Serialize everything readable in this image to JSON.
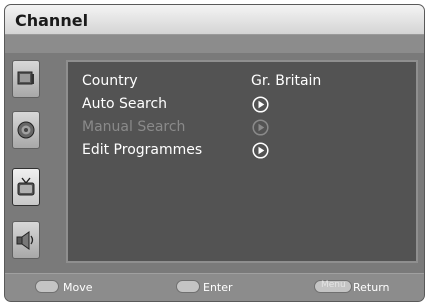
{
  "window": {
    "title": "Channel"
  },
  "menu": {
    "items": [
      {
        "label": "Country",
        "value": "Gr. Britain"
      },
      {
        "label": "Auto Search",
        "action_icon": "play-circle-icon"
      },
      {
        "label": "Manual Search",
        "action_icon": "play-circle-icon",
        "disabled": true
      },
      {
        "label": "Edit Programmes",
        "action_icon": "play-circle-icon"
      }
    ]
  },
  "sidebar": {
    "icons": [
      "picture-icon",
      "sound-icon",
      "channel-tv-icon",
      "setup-icon"
    ],
    "active_index": 2
  },
  "footer": {
    "move_label": "Move",
    "enter_label": "Enter",
    "menu_key_label": "Menu",
    "return_label": "Return"
  },
  "colors": {
    "panel": "#535353",
    "frame": "#7a7a7a",
    "text": "#ffffff",
    "disabled_text": "#8a8a8a"
  }
}
